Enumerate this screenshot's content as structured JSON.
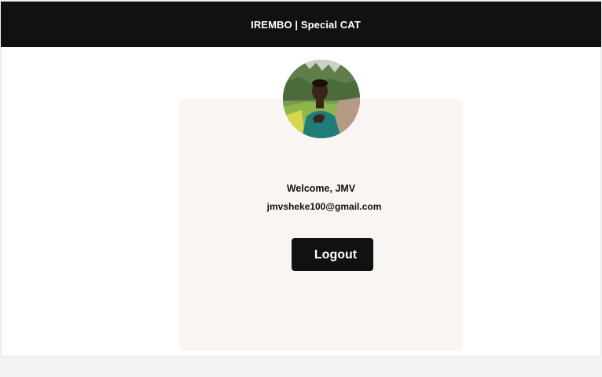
{
  "header": {
    "title": "IREMBO | Special CAT"
  },
  "profile": {
    "avatar_icon": "user-photo",
    "welcome_text": "Welcome, JMV",
    "email": "jmvsheke100@gmail.com"
  },
  "actions": {
    "logout_label": "Logout"
  },
  "colors": {
    "header_bg": "#111111",
    "card_bg": "#f9f5f3",
    "button_bg": "#111111",
    "page_bg": "#ffffff"
  }
}
